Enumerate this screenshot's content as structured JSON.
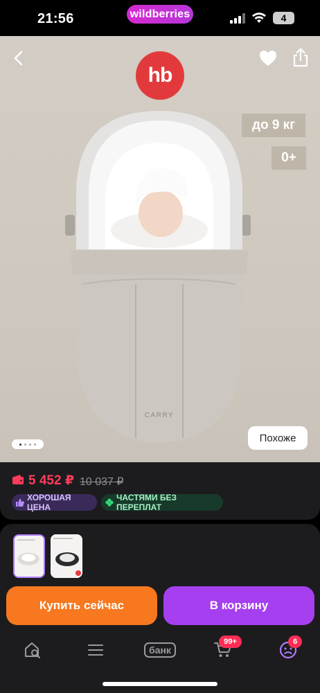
{
  "status_bar": {
    "time": "21:56",
    "app_pill": "wildberries",
    "battery": "4"
  },
  "product": {
    "brand_logo": "hb",
    "spec_weight": "до 9 кг",
    "spec_age": "0+",
    "product_label": "CARRY",
    "gallery_total": 4,
    "gallery_active": 1,
    "similar_label": "Похоже"
  },
  "price": {
    "current": "5 452 ₽",
    "old": "10 037 ₽",
    "tags": [
      {
        "label": "ХОРОШАЯ ЦЕНА"
      },
      {
        "label": "ЧАСТЯМИ БЕЗ ПЕРЕПЛАТ"
      }
    ]
  },
  "actions": {
    "buy_now": "Купить сейчас",
    "add_to_cart": "В корзину"
  },
  "nav": {
    "bank": "банк",
    "cart_badge": "99+",
    "profile_badge": "6"
  },
  "colors": {
    "price": "#ff3b5c",
    "buy_button": "#f7781f",
    "cart_button": "#a63ff0",
    "brand_logo": "#e23a3c"
  }
}
